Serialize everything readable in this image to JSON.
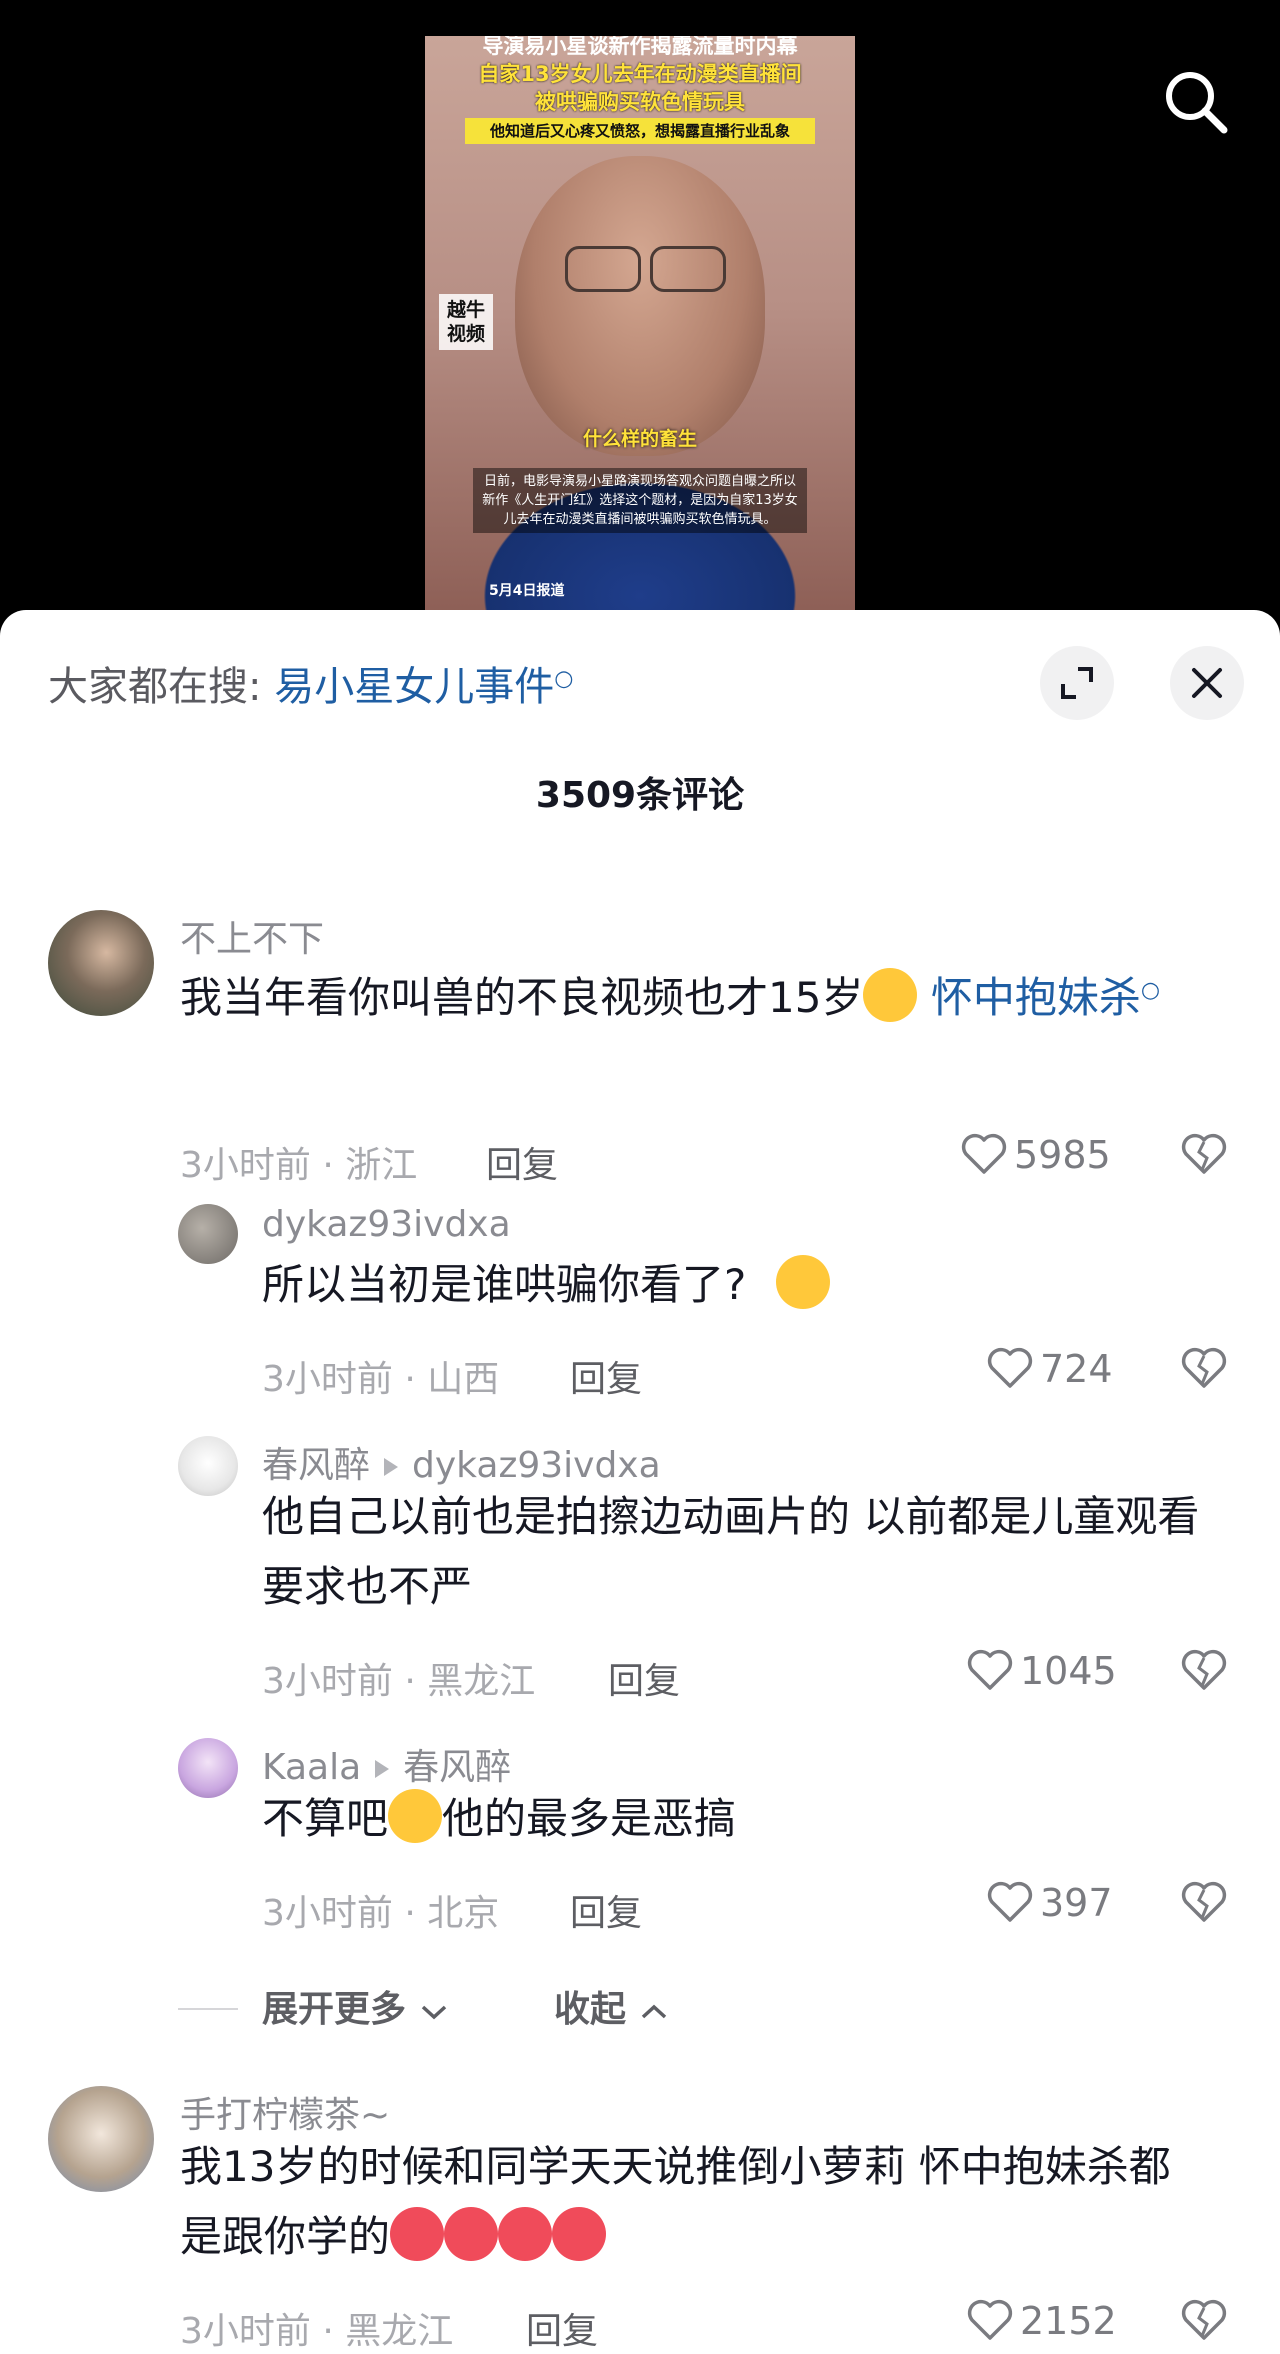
{
  "video": {
    "overlay_line1": "导演易小星谈新作揭露流量时内幕",
    "overlay_line2": "自家13岁女儿去年在动漫类直播间",
    "overlay_line3": "被哄骗购买软色情玩具",
    "overlay_strip": "他知道后又心疼又愤怒，想揭露直播行业乱象",
    "watermark": "越牛视频",
    "caption": "什么样的畜生",
    "description": "日前，电影导演易小星路演现场答观众问题自曝之所以新作《人生开门红》选择这个题材，是因为自家13岁女儿去年在动漫类直播间被哄骗购买软色情玩具。",
    "date": "5月4日报道"
  },
  "panel": {
    "hot_search_prefix": "大家都在搜: ",
    "hot_search_link": "易小星女儿事件",
    "comment_count": "3509条评论"
  },
  "comments": [
    {
      "user": "不上不下",
      "text": "我当年看你叫兽的不良视频也才15岁",
      "link": "怀中抱妹杀",
      "meta": "3小时前 · 浙江",
      "reply": "回复",
      "likes": "5985"
    },
    {
      "user": "dykaz93ivdxa",
      "text": "所以当初是谁哄骗你看了?",
      "meta": "3小时前 · 山西",
      "reply": "回复",
      "likes": "724"
    },
    {
      "user": "春风醉",
      "reply_to": "dykaz93ivdxa",
      "text": "他自己以前也是拍擦边动画片的 以前都是儿童观看 要求也不严",
      "meta": "3小时前 · 黑龙江",
      "reply": "回复",
      "likes": "1045"
    },
    {
      "user": "Kaala",
      "reply_to": "春风醉",
      "text_before": "不算吧",
      "text_after": "他的最多是恶搞",
      "meta": "3小时前 · 北京",
      "reply": "回复",
      "likes": "397"
    },
    {
      "user": "手打柠檬茶~",
      "text": "我13岁的时候和同学天天说推倒小萝莉 怀中抱妹杀都是跟你学的",
      "meta": "3小时前 · 黑龙江",
      "reply": "回复",
      "likes": "2152"
    }
  ],
  "thread_controls": {
    "expand_more": "展开更多",
    "collapse": "收起"
  },
  "colors": {
    "link": "#1f5ea3",
    "meta": "#a8a9ae",
    "text": "#161823"
  },
  "icons": [
    "search-icon",
    "expand-icon",
    "close-icon",
    "heart-icon",
    "broken-heart-icon",
    "chevron-down-icon",
    "chevron-up-icon"
  ]
}
